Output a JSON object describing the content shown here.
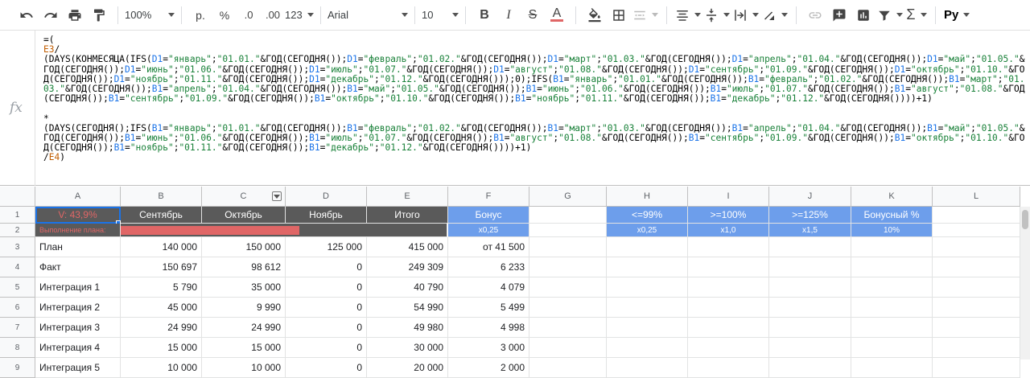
{
  "toolbar": {
    "zoom": "100%",
    "currency": "р.",
    "percent": "%",
    "dec_decrease": ".0",
    "dec_increase": ".00",
    "number_format": "123",
    "font_name": "Arial",
    "font_size": "10",
    "input_tool": "Ру"
  },
  "formula": {
    "fx_label": "fx",
    "parts": [
      [
        "k",
        "=(\n"
      ],
      [
        "r",
        "E3"
      ],
      [
        "k",
        "/\n(DAYS(КОНМЕСЯЦА(IFS("
      ],
      [
        "b",
        "D1"
      ],
      [
        "k",
        "="
      ],
      [
        "g",
        "\"январь\""
      ],
      [
        "k",
        ";"
      ],
      [
        "g",
        "\"01.01.\""
      ],
      [
        "k",
        "&ГОД(СЕГОДНЯ());"
      ],
      [
        "b",
        "D1"
      ],
      [
        "k",
        "="
      ],
      [
        "g",
        "\"февраль\""
      ],
      [
        "k",
        ";"
      ],
      [
        "g",
        "\"01.02.\""
      ],
      [
        "k",
        "&ГОД(СЕГОДНЯ());"
      ],
      [
        "b",
        "D1"
      ],
      [
        "k",
        "="
      ],
      [
        "g",
        "\"март\""
      ],
      [
        "k",
        ";"
      ],
      [
        "g",
        "\"01.03.\""
      ],
      [
        "k",
        "&ГОД(СЕГОДНЯ());"
      ],
      [
        "b",
        "D1"
      ],
      [
        "k",
        "="
      ],
      [
        "g",
        "\"апрель\""
      ],
      [
        "k",
        ";"
      ],
      [
        "g",
        "\"01.04.\""
      ],
      [
        "k",
        "&ГОД(СЕГОДНЯ());"
      ],
      [
        "b",
        "D1"
      ],
      [
        "k",
        "="
      ],
      [
        "g",
        "\"май\""
      ],
      [
        "k",
        ";"
      ],
      [
        "g",
        "\"01.05.\""
      ],
      [
        "k",
        "&ГОД(СЕГОДНЯ());"
      ],
      [
        "b",
        "D1"
      ],
      [
        "k",
        "="
      ],
      [
        "g",
        "\"июнь\""
      ],
      [
        "k",
        ";"
      ],
      [
        "g",
        "\"01.06.\""
      ],
      [
        "k",
        "&ГОД(СЕГОДНЯ());"
      ],
      [
        "b",
        "D1"
      ],
      [
        "k",
        "="
      ],
      [
        "g",
        "\"июль\""
      ],
      [
        "k",
        ";"
      ],
      [
        "g",
        "\"01.07.\""
      ],
      [
        "k",
        "&ГОД(СЕГОДНЯ());"
      ],
      [
        "b",
        "D1"
      ],
      [
        "k",
        "="
      ],
      [
        "g",
        "\"август\""
      ],
      [
        "k",
        ";"
      ],
      [
        "g",
        "\"01.08.\""
      ],
      [
        "k",
        "&ГОД(СЕГОДНЯ());"
      ],
      [
        "b",
        "D1"
      ],
      [
        "k",
        "="
      ],
      [
        "g",
        "\"сентябрь\""
      ],
      [
        "k",
        ";"
      ],
      [
        "g",
        "\"01.09.\""
      ],
      [
        "k",
        "&ГОД(СЕГОДНЯ());"
      ],
      [
        "b",
        "D1"
      ],
      [
        "k",
        "="
      ],
      [
        "g",
        "\"октябрь\""
      ],
      [
        "k",
        ";"
      ],
      [
        "g",
        "\"01.10.\""
      ],
      [
        "k",
        "&ГОД(СЕГОДНЯ());"
      ],
      [
        "b",
        "D1"
      ],
      [
        "k",
        "="
      ],
      [
        "g",
        "\"ноябрь\""
      ],
      [
        "k",
        ";"
      ],
      [
        "g",
        "\"01.11.\""
      ],
      [
        "k",
        "&ГОД(СЕГОДНЯ());"
      ],
      [
        "b",
        "D1"
      ],
      [
        "k",
        "="
      ],
      [
        "g",
        "\"декабрь\""
      ],
      [
        "k",
        ";"
      ],
      [
        "g",
        "\"01.12.\""
      ],
      [
        "k",
        "&ГОД(СЕГОДНЯ()));0);IFS("
      ],
      [
        "b",
        "B1"
      ],
      [
        "k",
        "="
      ],
      [
        "g",
        "\"январь\""
      ],
      [
        "k",
        ";"
      ],
      [
        "g",
        "\"01.01.\""
      ],
      [
        "k",
        "&ГОД(СЕГОДНЯ());"
      ],
      [
        "b",
        "B1"
      ],
      [
        "k",
        "="
      ],
      [
        "g",
        "\"февраль\""
      ],
      [
        "k",
        ";"
      ],
      [
        "g",
        "\"01.02.\""
      ],
      [
        "k",
        "&ГОД(СЕГОДНЯ());"
      ],
      [
        "b",
        "B1"
      ],
      [
        "k",
        "="
      ],
      [
        "g",
        "\"март\""
      ],
      [
        "k",
        ";"
      ],
      [
        "g",
        "\"01.03.\""
      ],
      [
        "k",
        "&ГОД(СЕГОДНЯ());"
      ],
      [
        "b",
        "B1"
      ],
      [
        "k",
        "="
      ],
      [
        "g",
        "\"апрель\""
      ],
      [
        "k",
        ";"
      ],
      [
        "g",
        "\"01.04.\""
      ],
      [
        "k",
        "&ГОД(СЕГОДНЯ());"
      ],
      [
        "b",
        "B1"
      ],
      [
        "k",
        "="
      ],
      [
        "g",
        "\"май\""
      ],
      [
        "k",
        ";"
      ],
      [
        "g",
        "\"01.05.\""
      ],
      [
        "k",
        "&ГОД(СЕГОДНЯ());"
      ],
      [
        "b",
        "B1"
      ],
      [
        "k",
        "="
      ],
      [
        "g",
        "\"июнь\""
      ],
      [
        "k",
        ";"
      ],
      [
        "g",
        "\"01.06.\""
      ],
      [
        "k",
        "&ГОД(СЕГОДНЯ());"
      ],
      [
        "b",
        "B1"
      ],
      [
        "k",
        "="
      ],
      [
        "g",
        "\"июль\""
      ],
      [
        "k",
        ";"
      ],
      [
        "g",
        "\"01.07.\""
      ],
      [
        "k",
        "&ГОД(СЕГОДНЯ());"
      ],
      [
        "b",
        "B1"
      ],
      [
        "k",
        "="
      ],
      [
        "g",
        "\"август\""
      ],
      [
        "k",
        ";"
      ],
      [
        "g",
        "\"01.08.\""
      ],
      [
        "k",
        "&ГОД(СЕГОДНЯ());"
      ],
      [
        "b",
        "B1"
      ],
      [
        "k",
        "="
      ],
      [
        "g",
        "\"сентябрь\""
      ],
      [
        "k",
        ";"
      ],
      [
        "g",
        "\"01.09.\""
      ],
      [
        "k",
        "&ГОД(СЕГОДНЯ());"
      ],
      [
        "b",
        "B1"
      ],
      [
        "k",
        "="
      ],
      [
        "g",
        "\"октябрь\""
      ],
      [
        "k",
        ";"
      ],
      [
        "g",
        "\"01.10.\""
      ],
      [
        "k",
        "&ГОД(СЕГОДНЯ());"
      ],
      [
        "b",
        "B1"
      ],
      [
        "k",
        "="
      ],
      [
        "g",
        "\"ноябрь\""
      ],
      [
        "k",
        ";"
      ],
      [
        "g",
        "\"01.11.\""
      ],
      [
        "k",
        "&ГОД(СЕГОДНЯ());"
      ],
      [
        "b",
        "B1"
      ],
      [
        "k",
        "="
      ],
      [
        "g",
        "\"декабрь\""
      ],
      [
        "k",
        ";"
      ],
      [
        "g",
        "\"01.12.\""
      ],
      [
        "k",
        "&ГОД(СЕГОДНЯ())))+1)\n\n*\n(DAYS(СЕГОДНЯ();IFS("
      ],
      [
        "b",
        "B1"
      ],
      [
        "k",
        "="
      ],
      [
        "g",
        "\"январь\""
      ],
      [
        "k",
        ";"
      ],
      [
        "g",
        "\"01.01.\""
      ],
      [
        "k",
        "&ГОД(СЕГОДНЯ());"
      ],
      [
        "b",
        "B1"
      ],
      [
        "k",
        "="
      ],
      [
        "g",
        "\"февраль\""
      ],
      [
        "k",
        ";"
      ],
      [
        "g",
        "\"01.02.\""
      ],
      [
        "k",
        "&ГОД(СЕГОДНЯ());"
      ],
      [
        "b",
        "B1"
      ],
      [
        "k",
        "="
      ],
      [
        "g",
        "\"март\""
      ],
      [
        "k",
        ";"
      ],
      [
        "g",
        "\"01.03.\""
      ],
      [
        "k",
        "&ГОД(СЕГОДНЯ());"
      ],
      [
        "b",
        "B1"
      ],
      [
        "k",
        "="
      ],
      [
        "g",
        "\"апрель\""
      ],
      [
        "k",
        ";"
      ],
      [
        "g",
        "\"01.04.\""
      ],
      [
        "k",
        "&ГОД(СЕГОДНЯ());"
      ],
      [
        "b",
        "B1"
      ],
      [
        "k",
        "="
      ],
      [
        "g",
        "\"май\""
      ],
      [
        "k",
        ";"
      ],
      [
        "g",
        "\"01.05.\""
      ],
      [
        "k",
        "&ГОД(СЕГОДНЯ());"
      ],
      [
        "b",
        "B1"
      ],
      [
        "k",
        "="
      ],
      [
        "g",
        "\"июнь\""
      ],
      [
        "k",
        ";"
      ],
      [
        "g",
        "\"01.06.\""
      ],
      [
        "k",
        "&ГОД(СЕГОДНЯ());"
      ],
      [
        "b",
        "B1"
      ],
      [
        "k",
        "="
      ],
      [
        "g",
        "\"июль\""
      ],
      [
        "k",
        ";"
      ],
      [
        "g",
        "\"01.07.\""
      ],
      [
        "k",
        "&ГОД(СЕГОДНЯ());"
      ],
      [
        "b",
        "B1"
      ],
      [
        "k",
        "="
      ],
      [
        "g",
        "\"август\""
      ],
      [
        "k",
        ";"
      ],
      [
        "g",
        "\"01.08.\""
      ],
      [
        "k",
        "&ГОД(СЕГОДНЯ());"
      ],
      [
        "b",
        "B1"
      ],
      [
        "k",
        "="
      ],
      [
        "g",
        "\"сентябрь\""
      ],
      [
        "k",
        ";"
      ],
      [
        "g",
        "\"01.09.\""
      ],
      [
        "k",
        "&ГОД(СЕГОДНЯ());"
      ],
      [
        "b",
        "B1"
      ],
      [
        "k",
        "="
      ],
      [
        "g",
        "\"октябрь\""
      ],
      [
        "k",
        ";"
      ],
      [
        "g",
        "\"01.10.\""
      ],
      [
        "k",
        "&ГОД(СЕГОДНЯ());"
      ],
      [
        "b",
        "B1"
      ],
      [
        "k",
        "="
      ],
      [
        "g",
        "\"ноябрь\""
      ],
      [
        "k",
        ";"
      ],
      [
        "g",
        "\"01.11.\""
      ],
      [
        "k",
        "&ГОД(СЕГОДНЯ());"
      ],
      [
        "b",
        "B1"
      ],
      [
        "k",
        "="
      ],
      [
        "g",
        "\"декабрь\""
      ],
      [
        "k",
        ";"
      ],
      [
        "g",
        "\"01.12.\""
      ],
      [
        "k",
        "&ГОД(СЕГОДНЯ())))+1)\n/"
      ],
      [
        "r",
        "E4"
      ],
      [
        "k",
        ")"
      ]
    ]
  },
  "columns": [
    "A",
    "B",
    "C",
    "D",
    "E",
    "F",
    "G",
    "H",
    "I",
    "J",
    "K",
    "L"
  ],
  "rows": [
    "1",
    "2",
    "3",
    "4",
    "5",
    "6",
    "7",
    "8",
    "9"
  ],
  "sheet": {
    "a1": "V: 43,9%",
    "headers": [
      "Сентябрь",
      "Октябрь",
      "Ноябрь",
      "Итого"
    ],
    "bonus_label": "Бонус",
    "a2": "Выполнение плана:",
    "f2": "x0,25",
    "plan_progress": 0.439,
    "data_rows": [
      [
        "План",
        "140 000",
        "150 000",
        "125 000",
        "415 000",
        "от 41 500"
      ],
      [
        "Факт",
        "150 697",
        "98 612",
        "0",
        "249 309",
        "6 233"
      ],
      [
        "Интеграция 1",
        "5 790",
        "35 000",
        "0",
        "40 790",
        "4 079"
      ],
      [
        "Интеграция 2",
        "45 000",
        "9 990",
        "0",
        "54 990",
        "5 499"
      ],
      [
        "Интеграция 3",
        "24 990",
        "24 990",
        "0",
        "49 980",
        "4 998"
      ],
      [
        "Интеграция 4",
        "15 000",
        "15 000",
        "0",
        "30 000",
        "3 000"
      ],
      [
        "Интеграция 5",
        "10 000",
        "10 000",
        "0",
        "20 000",
        "2 000"
      ]
    ],
    "tier_headers": [
      "<=99%",
      ">=100%",
      ">=125%",
      "Бонусный %"
    ],
    "tier_values": [
      "x0,25",
      "x1,0",
      "x1,5",
      "10%"
    ]
  },
  "colors": {
    "dark_header": "#5a5a5a",
    "blue_header": "#6d9eeb",
    "progress_red": "#e06666",
    "a1_text": "#e06666"
  }
}
